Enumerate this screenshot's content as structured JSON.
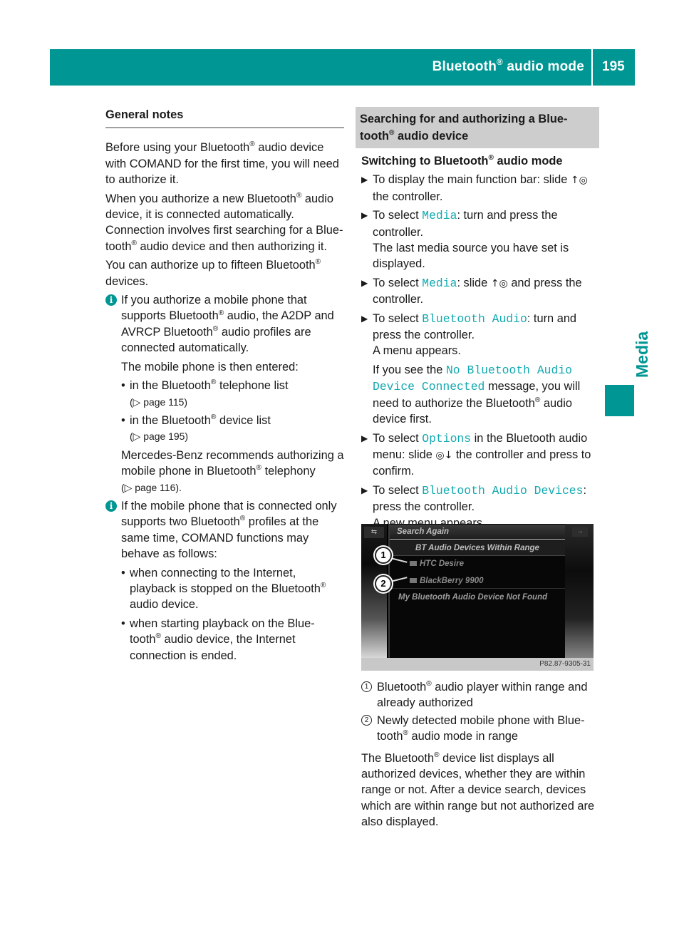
{
  "header": {
    "title": "Bluetooth",
    "title_suffix": " audio mode",
    "reg": "®",
    "page_number": "195"
  },
  "side_tab": {
    "label": "Media"
  },
  "general_notes": {
    "heading": "General notes",
    "p1": {
      "a": "Before using your Bluetooth",
      "b": " audio device with COMAND for the first time, you will need to authorize it."
    },
    "p2": {
      "a": "When you authorize a new Bluetooth",
      "b": " audio device, it is connected automatically. Connection involves first searching for a Blue-tooth",
      "c": " audio device and then authorizing it."
    },
    "p3": {
      "a": "You can authorize up to fifteen Bluetooth",
      "b": " devices."
    },
    "info1": {
      "a": "If you authorize a mobile phone that supports Bluetooth",
      "b": " audio, the A2DP and AVRCP Bluetooth",
      "c": " audio profiles are connected automatically.",
      "entered": "The mobile phone is then entered:",
      "bullets": [
        {
          "a": "in the Bluetooth",
          "b": " telephone list",
          "ref": "(▷ page 115)"
        },
        {
          "a": "in the Bluetooth",
          "b": " device list",
          "ref": "(▷ page 195)"
        }
      ],
      "recommend_a": "Mercedes-Benz recommends authorizing a mobile phone in Bluetooth",
      "recommend_b": " telephony",
      "recommend_ref": "(▷ page 116)."
    },
    "info2": {
      "a": "If the mobile phone that is connected only supports two Bluetooth",
      "b": " profiles at the same time, COMAND functions may behave as follows:",
      "bullets": [
        {
          "a": "when connecting to the Internet, playback is stopped on the Bluetooth",
          "b": " audio device."
        },
        {
          "a": "when starting playback on the Blue-tooth",
          "b": " audio device, the Internet connection is ended."
        }
      ]
    }
  },
  "searching": {
    "heading_a": "Searching for and authorizing a Blue-tooth",
    "heading_b": " audio device",
    "sub_a": "Switching to Bluetooth",
    "sub_b": " audio mode",
    "steps": [
      {
        "a": "To display the main function bar: slide ",
        "ctrl": "↑◎",
        "b": " the controller."
      },
      {
        "a": "To select ",
        "mono": "Media",
        "b": ": turn and press the controller.",
        "note": "The last media source you have set is displayed."
      },
      {
        "a": "To select ",
        "mono": "Media",
        "b": ": slide ",
        "ctrl": "↑◎",
        "c": " and press the controller."
      },
      {
        "a": "To select ",
        "mono": "Bluetooth Audio",
        "b": ": turn and press the controller.",
        "note": "A menu appears.",
        "note2_a": "If you see the ",
        "note2_mono": "No Bluetooth Audio Device Connected",
        "note2_b": " message, you will need to authorize the Bluetooth",
        "note2_c": " audio device first."
      },
      {
        "a": "To select ",
        "mono": "Options",
        "b": " in the Bluetooth audio menu: slide ",
        "ctrl": "◎↓",
        "c": " the controller and press to confirm."
      },
      {
        "a": "To select ",
        "mono": "Bluetooth Audio Devices",
        "b": ": press the controller.",
        "note": "A new menu appears."
      }
    ],
    "arrow": "▶",
    "bullet": "•"
  },
  "screen": {
    "back_icon": "⇆",
    "right_icon": "→",
    "search_again": "Search Again",
    "group_title": "BT Audio Devices Within Range",
    "devices": [
      "HTC Desire",
      "BlackBerry 9900"
    ],
    "not_found": "My Bluetooth Audio Device Not Found",
    "image_code": "P82.87-9305-31",
    "callouts": [
      "1",
      "2"
    ]
  },
  "legend": [
    {
      "num": "1",
      "a": "Bluetooth",
      "b": " audio player within range and already authorized"
    },
    {
      "num": "2",
      "a": "Newly detected mobile phone with Blue-tooth",
      "b": " audio mode in range"
    }
  ],
  "closing": {
    "a": "The Bluetooth",
    "b": " device list displays all authorized devices, whether they are within range or not. After a device search, devices which are within range but not authorized are also displayed."
  },
  "colors": {
    "accent": "#009693",
    "mono_text": "#13a9b0",
    "section_bg": "#cdcdcd"
  }
}
